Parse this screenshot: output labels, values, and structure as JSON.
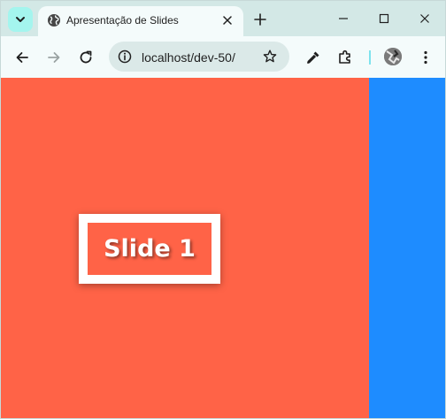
{
  "tab": {
    "title": "Apresentação de Slides",
    "favicon": "globe-icon"
  },
  "address_bar": {
    "url": "localhost/dev-50/"
  },
  "toolbar": {
    "icons": [
      "back-icon",
      "forward-icon",
      "reload-icon",
      "site-info-icon",
      "bookmark-star-icon",
      "eyedropper-icon",
      "extensions-icon",
      "profile-avatar",
      "menu-icon"
    ]
  },
  "window_controls": [
    "minimize-icon",
    "maximize-icon",
    "close-icon"
  ],
  "page": {
    "slide_label": "Slide 1",
    "slide_color": "#ff6347",
    "next_slide_color": "#1e8cff"
  },
  "colors": {
    "titlebar": "#d3e8e6",
    "toolbar": "#f4fbfb",
    "accent": "#a4f5ee"
  }
}
